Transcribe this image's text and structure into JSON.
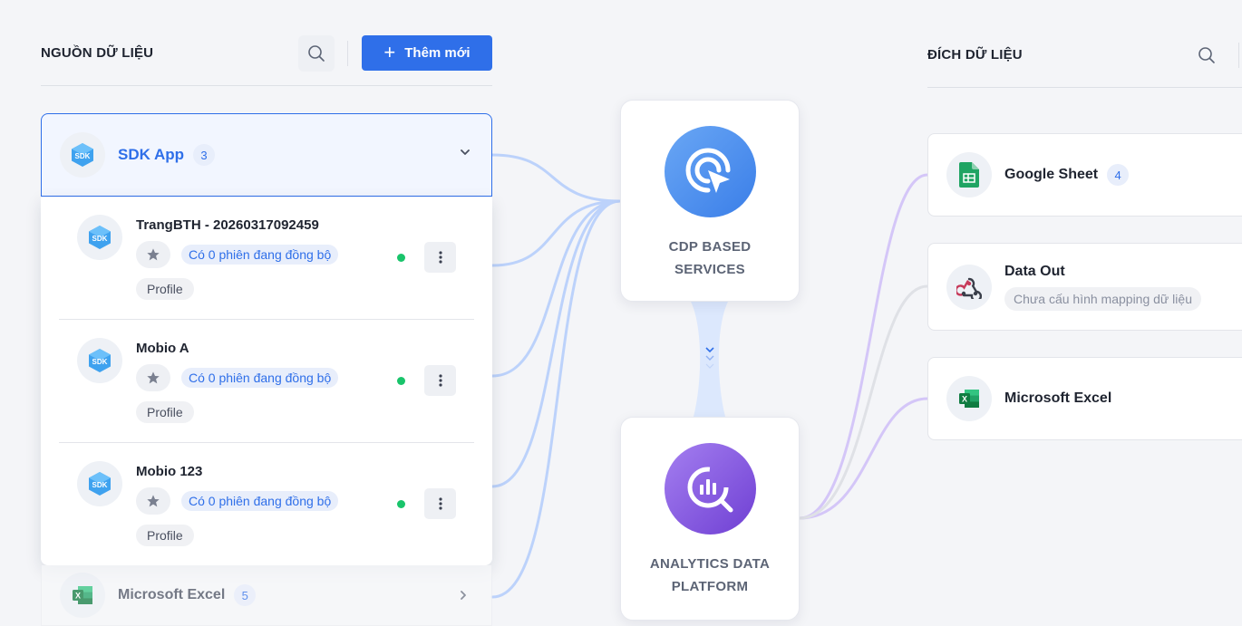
{
  "source_panel": {
    "title": "NGUỒN DỮ LIỆU",
    "add_button_label": "Thêm mới",
    "groups": [
      {
        "name": "SDK App",
        "count": "3",
        "icon": "sdk-icon",
        "items": [
          {
            "name": "TrangBTH - 20260317092459",
            "sync_text": "Có 0 phiên đang đồng bộ",
            "tag": "Profile",
            "status": "active"
          },
          {
            "name": "Mobio A",
            "sync_text": "Có 0 phiên đang đồng bộ",
            "tag": "Profile",
            "status": "active"
          },
          {
            "name": "Mobio 123",
            "sync_text": "Có 0 phiên đang đồng bộ",
            "tag": "Profile",
            "status": "active"
          }
        ]
      },
      {
        "name": "Microsoft Excel",
        "count": "5",
        "icon": "excel-icon"
      }
    ]
  },
  "center": {
    "cdp_label": "CDP BASED\nSERVICES",
    "analytics_label": "ANALYTICS DATA\nPLATFORM"
  },
  "destination_panel": {
    "title": "ĐÍCH DỮ LIỆU",
    "items": [
      {
        "name": "Google Sheet",
        "count": "4",
        "icon": "google-sheet-icon"
      },
      {
        "name": "Data Out",
        "subtitle": "Chưa cấu hình mapping dữ liệu",
        "icon": "webhook-icon"
      },
      {
        "name": "Microsoft Excel",
        "icon": "excel-icon"
      }
    ]
  },
  "colors": {
    "primary": "#2f6fe9",
    "status_active": "#19c46b",
    "cdp_gradient": [
      "#4e8df0",
      "#7ab0f7"
    ],
    "analytics_gradient": [
      "#7b4fd8",
      "#a88cf0"
    ],
    "connector_blue": "#b9d0fb",
    "connector_purple": "#d2c2f7",
    "connector_gray": "#dcdfe5"
  }
}
